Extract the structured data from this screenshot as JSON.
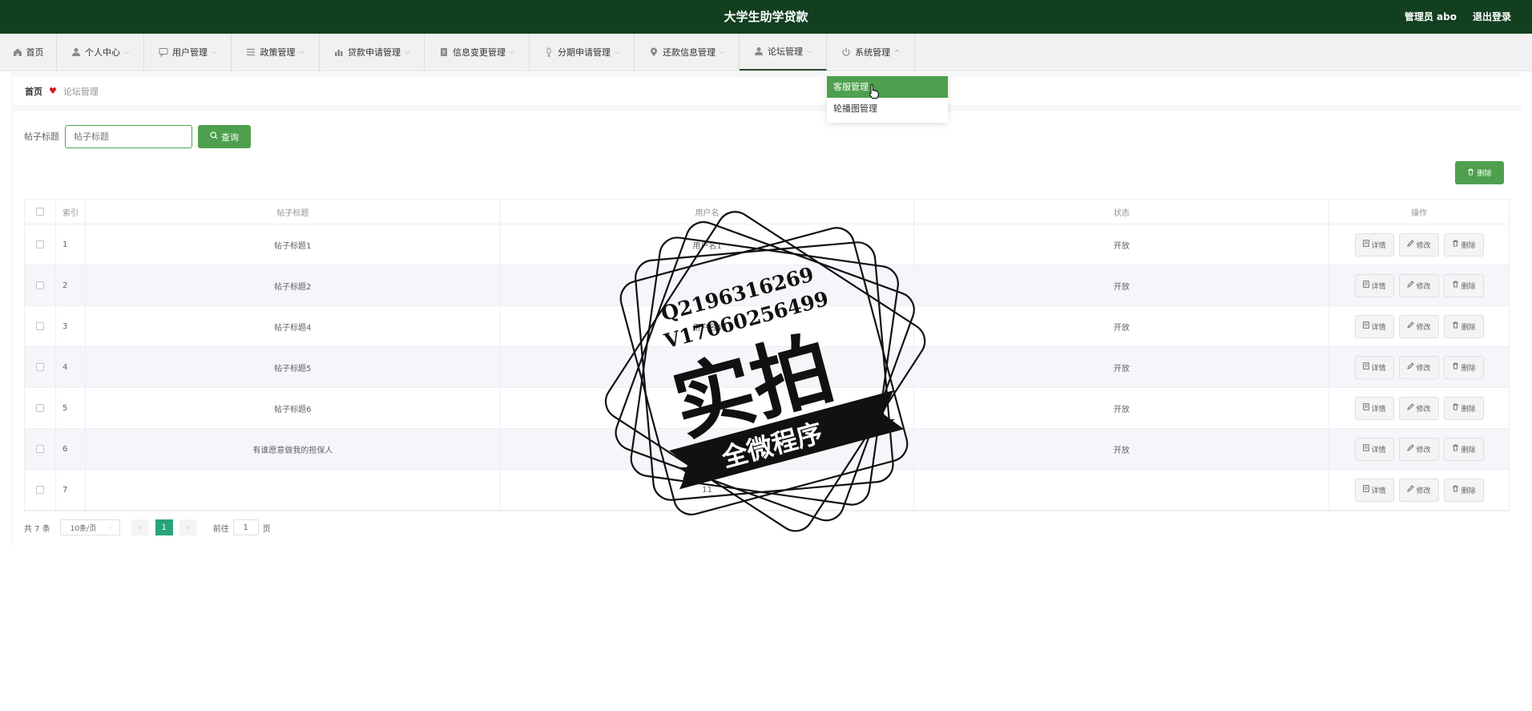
{
  "header": {
    "title": "大学生助学贷款",
    "user_label": "管理员 abo",
    "logout_label": "退出登录"
  },
  "menu": [
    {
      "label": "首页",
      "icon": "home-icon"
    },
    {
      "label": "个人中心",
      "icon": "user-icon"
    },
    {
      "label": "用户管理",
      "icon": "chat-icon"
    },
    {
      "label": "政策管理",
      "icon": "list-icon"
    },
    {
      "label": "贷款申请管理",
      "icon": "chart-icon"
    },
    {
      "label": "信息变更管理",
      "icon": "document-icon"
    },
    {
      "label": "分期申请管理",
      "icon": "mic-icon"
    },
    {
      "label": "还款信息管理",
      "icon": "location-icon"
    },
    {
      "label": "论坛管理",
      "icon": "user-icon"
    },
    {
      "label": "系统管理",
      "icon": "power-icon"
    }
  ],
  "dropdown": {
    "items": [
      "客服管理",
      "轮播图管理"
    ],
    "highlighted": "客服管理"
  },
  "breadcrumb": {
    "home": "首页",
    "current": "论坛管理"
  },
  "search": {
    "label": "帖子标题",
    "placeholder": "帖子标题",
    "button_label": "查询"
  },
  "actions": {
    "delete_label": "删除"
  },
  "table": {
    "headers": [
      "索引",
      "帖子标题",
      "用户名",
      "状态",
      "操作"
    ],
    "rows": [
      {
        "index": "1",
        "title": "帖子标题1",
        "username": "用户名1",
        "status": "开放"
      },
      {
        "index": "2",
        "title": "帖子标题2",
        "username": "",
        "status": "开放"
      },
      {
        "index": "3",
        "title": "帖子标题4",
        "username": "用户名4",
        "status": "开放"
      },
      {
        "index": "4",
        "title": "帖子标题5",
        "username": "",
        "status": "开放"
      },
      {
        "index": "5",
        "title": "帖子标题6",
        "username": "",
        "status": "开放"
      },
      {
        "index": "6",
        "title": "有谁愿意做我的担保人",
        "username": "",
        "status": "开放"
      },
      {
        "index": "7",
        "title": "",
        "username": "11",
        "status": ""
      }
    ],
    "row_actions": {
      "detail": "详情",
      "edit": "修改",
      "delete": "删除"
    }
  },
  "pagination": {
    "total": "共 7 条",
    "page_size": "10条/页",
    "current_page": "1",
    "goto_label": "前往",
    "goto_value": "1",
    "page_unit": "页"
  },
  "watermark": {
    "line1": "Q2196316269",
    "line2": "V17060256499",
    "big": "实拍",
    "ribbon": "全微程序"
  },
  "colors": {
    "header_bg": "#123f1f",
    "accent": "#4ea04e",
    "page_active": "#28a37a"
  }
}
